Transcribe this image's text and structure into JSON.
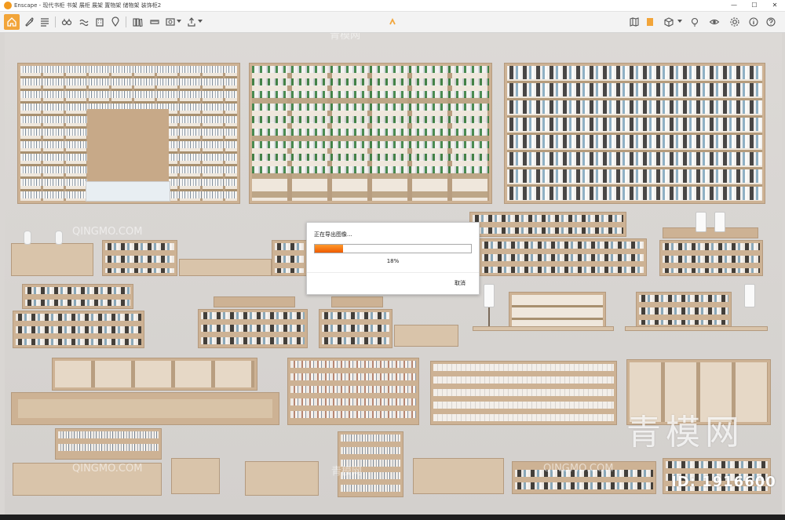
{
  "window": {
    "title": "Enscape - 现代书柜 书架 展柜 展架 置物架 储物架 装饰柜2",
    "minimize_glyph": "—",
    "maximize_glyph": "☐",
    "close_glyph": "✕"
  },
  "toolbar": {
    "icons_left": [
      "home-icon",
      "brush-icon",
      "list-icon",
      "binoculars-icon",
      "wave-icon",
      "building-icon",
      "map-pin-icon",
      "books-icon",
      "ruler-icon",
      "screenshot-icon",
      "export-icon",
      "upload-icon"
    ],
    "icons_right": [
      "map-icon",
      "bookmark-icon",
      "cube-icon",
      "lightbulb-icon",
      "eye-icon",
      "settings-icon",
      "info-icon",
      "help-icon"
    ]
  },
  "watermarks": {
    "qingmo_latin": "QINGMO.COM",
    "qingmo_cn": "青模网",
    "big": "青模网",
    "id": "ID: 1916600"
  },
  "export_dialog": {
    "message": "正在导出图像...",
    "progress_percent": 18,
    "progress_label": "18%",
    "cancel_label": "取消"
  },
  "colors": {
    "accent": "#f2a53a",
    "progress_start": "#ff9a2e",
    "progress_end": "#ef5b00"
  }
}
